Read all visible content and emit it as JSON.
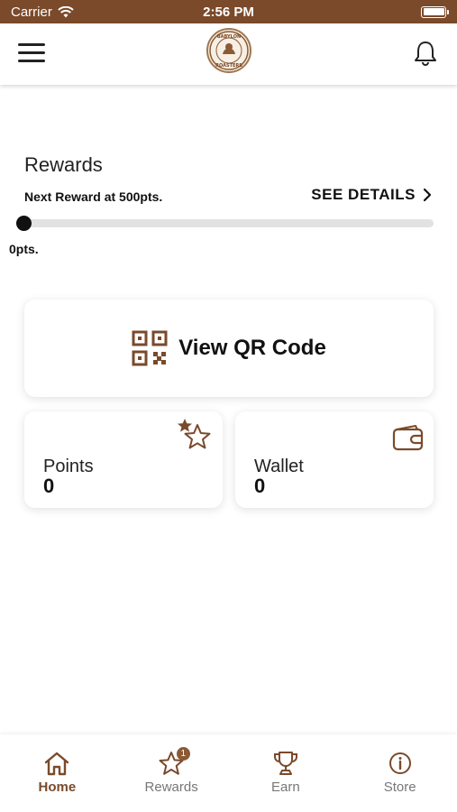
{
  "status_bar": {
    "carrier": "Carrier",
    "time": "2:56 PM"
  },
  "header": {
    "logo_text": "BABYLON COFFEE ROASTERS"
  },
  "rewards": {
    "title": "Rewards",
    "next_reward": "Next Reward at 500pts.",
    "see_details": "SEE DETAILS",
    "progress_min_label": "0pts.",
    "progress_fraction": 0
  },
  "qr_card": {
    "label": "View QR Code"
  },
  "points_card": {
    "label": "Points",
    "value": "0"
  },
  "wallet_card": {
    "label": "Wallet",
    "value": "0"
  },
  "bottom_nav": {
    "items": [
      {
        "label": "Home",
        "icon": "home-icon",
        "active": true
      },
      {
        "label": "Rewards",
        "icon": "star-icon",
        "badge": "1"
      },
      {
        "label": "Earn",
        "icon": "trophy-icon"
      },
      {
        "label": "Store",
        "icon": "info-icon"
      }
    ]
  },
  "colors": {
    "brand": "#7a4a2b",
    "accent": "#8a5a35",
    "progress_track": "#e2e2e2"
  }
}
